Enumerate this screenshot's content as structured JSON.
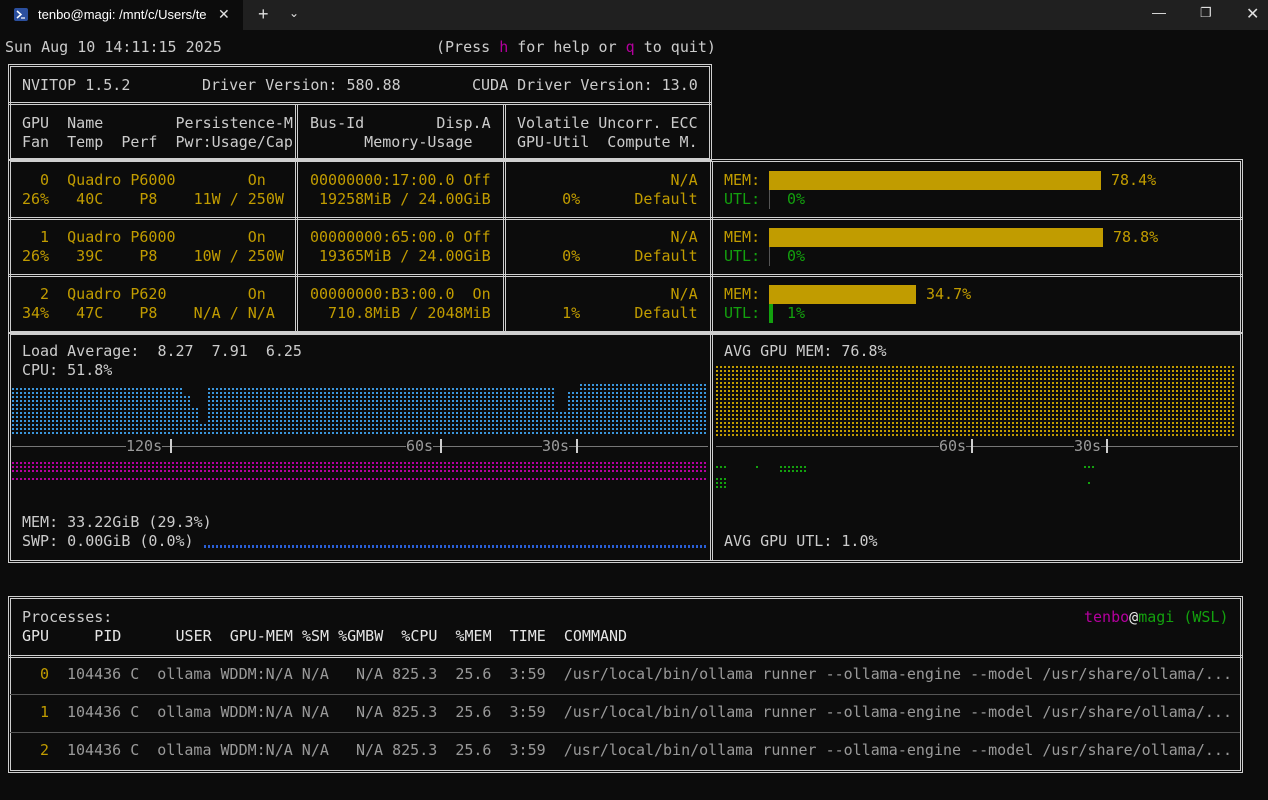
{
  "window": {
    "tab_title": "tenbo@magi: /mnt/c/Users/te",
    "close_tab": "✕",
    "new_tab": "+",
    "dropdown": "⌄",
    "minimize": "—",
    "maximize": "❐",
    "close": "✕"
  },
  "header": {
    "datetime": "Sun Aug 10 14:11:15 2025",
    "help_pre": "(Press ",
    "help_key": "h",
    "help_mid": " for help or ",
    "quit_key": "q",
    "help_post": " to quit)"
  },
  "info": {
    "nvitop": "NVITOP 1.5.2",
    "driver": "Driver Version: 580.88",
    "cuda": "CUDA Driver Version: 13.0"
  },
  "columns": {
    "c1_l1": "GPU  Name        Persistence-M",
    "c1_l2": "Fan  Temp  Perf  Pwr:Usage/Cap",
    "c2_l1": "Bus-Id        Disp.A",
    "c2_l2": "      Memory-Usage",
    "c3_l1": "Volatile Uncorr. ECC",
    "c3_l2": "GPU-Util  Compute M."
  },
  "gpus": [
    {
      "l1a": "  0  Quadro P6000        On",
      "l2a": "26%   40C    P8    11W / 250W",
      "l1b": "00000000:17:00.0 Off",
      "l2b": " 19258MiB / 24.00GiB",
      "l1c": "                 N/A",
      "l2c": "     0%      Default",
      "mem_label": "MEM:",
      "mem_pct": "78.4%",
      "mem_frac": 0.784,
      "utl_label": "UTL:",
      "utl_pct": "0%",
      "utl_frac": 0.0
    },
    {
      "l1a": "  1  Quadro P6000        On",
      "l2a": "26%   39C    P8    10W / 250W",
      "l1b": "00000000:65:00.0 Off",
      "l2b": " 19365MiB / 24.00GiB",
      "l1c": "                 N/A",
      "l2c": "     0%      Default",
      "mem_label": "MEM:",
      "mem_pct": "78.8%",
      "mem_frac": 0.788,
      "utl_label": "UTL:",
      "utl_pct": "0%",
      "utl_frac": 0.0
    },
    {
      "l1a": "  2  Quadro P620         On",
      "l2a": "34%   47C    P8    N/A / N/A",
      "l1b": "00000000:B3:00.0  On",
      "l2b": "  710.8MiB / 2048MiB",
      "l1c": "                 N/A",
      "l2c": "     1%      Default",
      "mem_label": "MEM:",
      "mem_pct": "34.7%",
      "mem_frac": 0.347,
      "utl_label": "UTL:",
      "utl_pct": "1%",
      "utl_frac": 0.01
    }
  ],
  "host": {
    "load_label": "Load Average:",
    "load_values": "8.27  7.91  6.25",
    "cpu": "CPU: 51.8%",
    "mem": "MEM: 33.22GiB (29.3%)",
    "swp": "SWP: 0.00GiB (0.0%)",
    "t120": "120s",
    "t60": "60s",
    "t30": "30s",
    "avg_gpu_mem": "AVG GPU MEM: 76.8%",
    "avg_gpu_utl": "AVG GPU UTL: 1.0%",
    "g60": "60s",
    "g30": "30s"
  },
  "processes": {
    "title": "Processes:",
    "user": "tenbo",
    "at": "@",
    "host": "magi",
    "wsl": " (WSL)",
    "header": "GPU     PID      USER  GPU-MEM %SM %GMBW  %CPU  %MEM  TIME  COMMAND",
    "rows": [
      {
        "gpu": "0",
        "rest": "104436 C  ollama WDDM:N/A N/A   N/A 825.3  25.6  3:59  /usr/local/bin/ollama runner --ollama-engine --model /usr/share/ollama/..."
      },
      {
        "gpu": "1",
        "rest": "104436 C  ollama WDDM:N/A N/A   N/A 825.3  25.6  3:59  /usr/local/bin/ollama runner --ollama-engine --model /usr/share/ollama/..."
      },
      {
        "gpu": "2",
        "rest": "104436 C  ollama WDDM:N/A N/A   N/A 825.3  25.6  3:59  /usr/local/bin/ollama runner --ollama-engine --model /usr/share/ollama/..."
      }
    ]
  },
  "colors": {
    "yellow": "#c19c00",
    "green": "#13a10e",
    "magenta": "#b4009e",
    "blue": "#3a96dd",
    "background": "#0c0c0c"
  }
}
